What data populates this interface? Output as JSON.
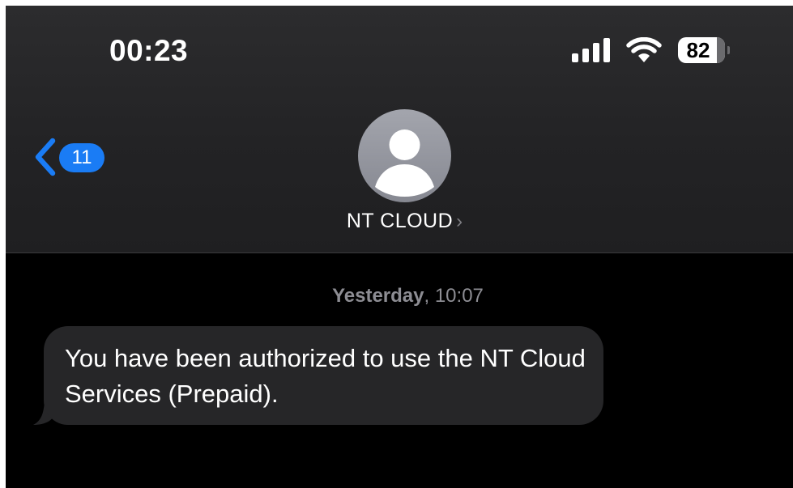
{
  "status_bar": {
    "time": "00:23",
    "battery_level": "82",
    "battery_fraction": 0.82,
    "signal_icon": "cellular-signal-icon",
    "wifi_icon": "wifi-icon"
  },
  "nav": {
    "back_badge_count": "11",
    "back_icon": "chevron-left-icon",
    "contact_name": "NT CLOUD",
    "contact_chevron": "›",
    "avatar_icon": "person-icon"
  },
  "conversation": {
    "timestamp_day": "Yesterday",
    "timestamp_time": ", 10:07",
    "messages": [
      {
        "direction": "incoming",
        "text": "You have been authorized to use the NT Cloud Services (Prepaid)."
      }
    ]
  },
  "colors": {
    "accent": "#1a7cf5",
    "background": "#000000",
    "header_background": "#2a2a2c",
    "bubble_incoming": "#262628",
    "timestamp": "#8d8d93"
  }
}
